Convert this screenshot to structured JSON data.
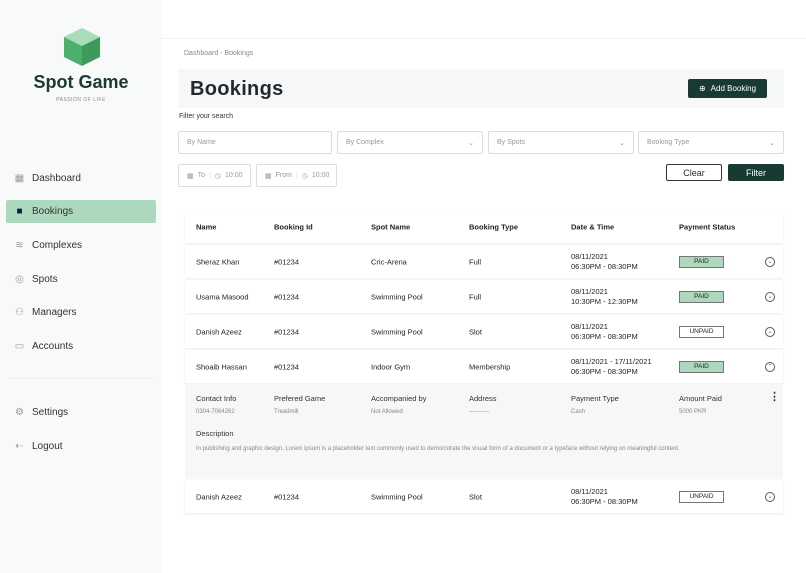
{
  "brand": {
    "name": "Spot Game",
    "tagline": "PASSION OF LIFE"
  },
  "nav": [
    {
      "label": "Dashboard",
      "icon": "grid-icon"
    },
    {
      "label": "Bookings",
      "icon": "book-icon",
      "active": true
    },
    {
      "label": "Complexes",
      "icon": "layers-icon"
    },
    {
      "label": "Spots",
      "icon": "target-icon"
    },
    {
      "label": "Managers",
      "icon": "user-check-icon"
    },
    {
      "label": "Accounts",
      "icon": "card-icon"
    }
  ],
  "nav_bottom": [
    {
      "label": "Settings",
      "icon": "gear-icon"
    },
    {
      "label": "Logout",
      "icon": "logout-icon"
    }
  ],
  "breadcrumb": "Dashboard  -  Bookings",
  "title": "Bookings",
  "add_booking": "Add Booking",
  "filter": {
    "label": "Filter your search",
    "by_name": "By Name",
    "by_complex": "By Complex",
    "by_spots": "By Spots",
    "booking_type": "Booking Type",
    "to": "To",
    "to_time": "10:00",
    "from": "From",
    "from_time": "10:00",
    "clear": "Clear",
    "filter": "Filter"
  },
  "columns": [
    "Name",
    "Booking Id",
    "Spot Name",
    "Booking Type",
    "Date & Time",
    "Payment Status"
  ],
  "rows": [
    {
      "name": "Sheraz Khan",
      "id": "#01234",
      "spot": "Cric-Arena",
      "type": "Full",
      "date": "08/11/2021",
      "time": "06:30PM - 08:30PM",
      "status": "PAID"
    },
    {
      "name": "Usama Masood",
      "id": "#01234",
      "spot": "Swimming Pool",
      "type": "Full",
      "date": "08/11/2021",
      "time": "10:30PM - 12:30PM",
      "status": "PAID"
    },
    {
      "name": "Danish Azeez",
      "id": "#01234",
      "spot": "Swimming Pool",
      "type": "Slot",
      "date": "08/11/2021",
      "time": "06:30PM - 08:30PM",
      "status": "UNPAID"
    },
    {
      "name": "Shoaib Hassan",
      "id": "#01234",
      "spot": "Indoor Gym",
      "type": "Membership",
      "date": "08/11/2021 - 17/11/2021",
      "time": "06:30PM - 08:30PM",
      "status": "PAID"
    },
    {
      "name": "Danish Azeez",
      "id": "#01234",
      "spot": "Swimming Pool",
      "type": "Slot",
      "date": "08/11/2021",
      "time": "06:30PM - 08:30PM",
      "status": "UNPAID"
    }
  ],
  "detail": {
    "fields": [
      {
        "k": "Contact Info",
        "v": "0304-7064262"
      },
      {
        "k": "Prefered Game",
        "v": "Treadmill"
      },
      {
        "k": "Accompanied by",
        "v": "Not Allowed"
      },
      {
        "k": "Address",
        "v": "----------"
      },
      {
        "k": "Payment Type",
        "v": "Cash"
      },
      {
        "k": "Amount Paid",
        "v": "5000 PKR"
      }
    ],
    "desc_label": "Description",
    "desc": "In publishing and graphic design, Lorem ipsum is a placeholder text commonly used to demonstrate the visual form of a document or a typeface without relying on meaningful content."
  },
  "colors": {
    "accent": "#173a33",
    "active": "#acd9bd"
  }
}
